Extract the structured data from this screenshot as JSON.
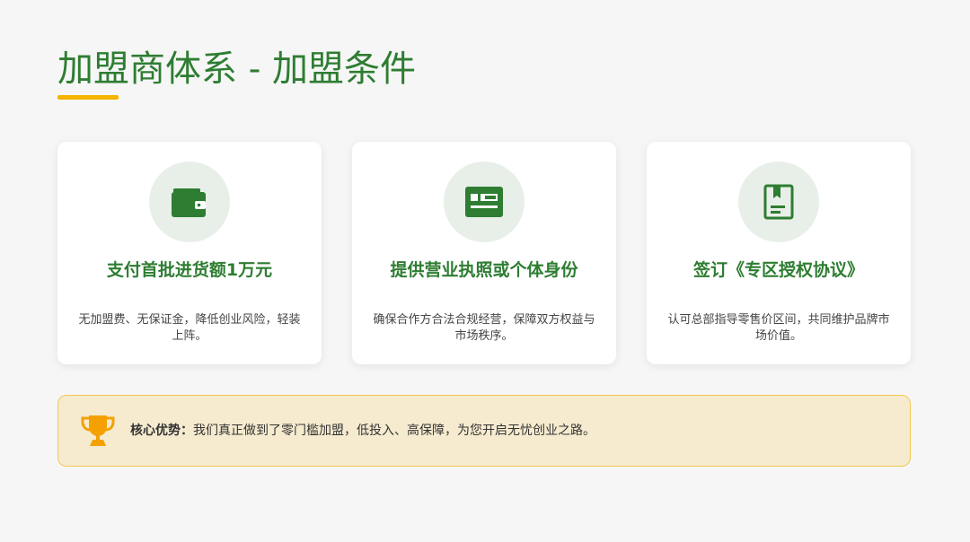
{
  "title": "加盟商体系 - 加盟条件",
  "colors": {
    "primary": "#2e7d32",
    "accent": "#f4b400",
    "icon_bg": "#e8efe8",
    "banner_bg": "#f6ebcf",
    "banner_border": "#f0c850"
  },
  "cards": [
    {
      "icon": "wallet-icon",
      "title": "支付首批进货额1万元",
      "description": "无加盟费、无保证金，降低创业风险，轻装上阵。"
    },
    {
      "icon": "id-card-icon",
      "title": "提供营业执照或个体身份",
      "description": "确保合作方合法合规经营，保障双方权益与市场秩序。"
    },
    {
      "icon": "agreement-book-icon",
      "title": "签订《专区授权协议》",
      "description": "认可总部指导零售价区间，共同维护品牌市场价值。"
    }
  ],
  "banner": {
    "icon": "trophy-icon",
    "label": "核心优势：",
    "text": "我们真正做到了零门槛加盟，低投入、高保障，为您开启无忧创业之路。"
  }
}
